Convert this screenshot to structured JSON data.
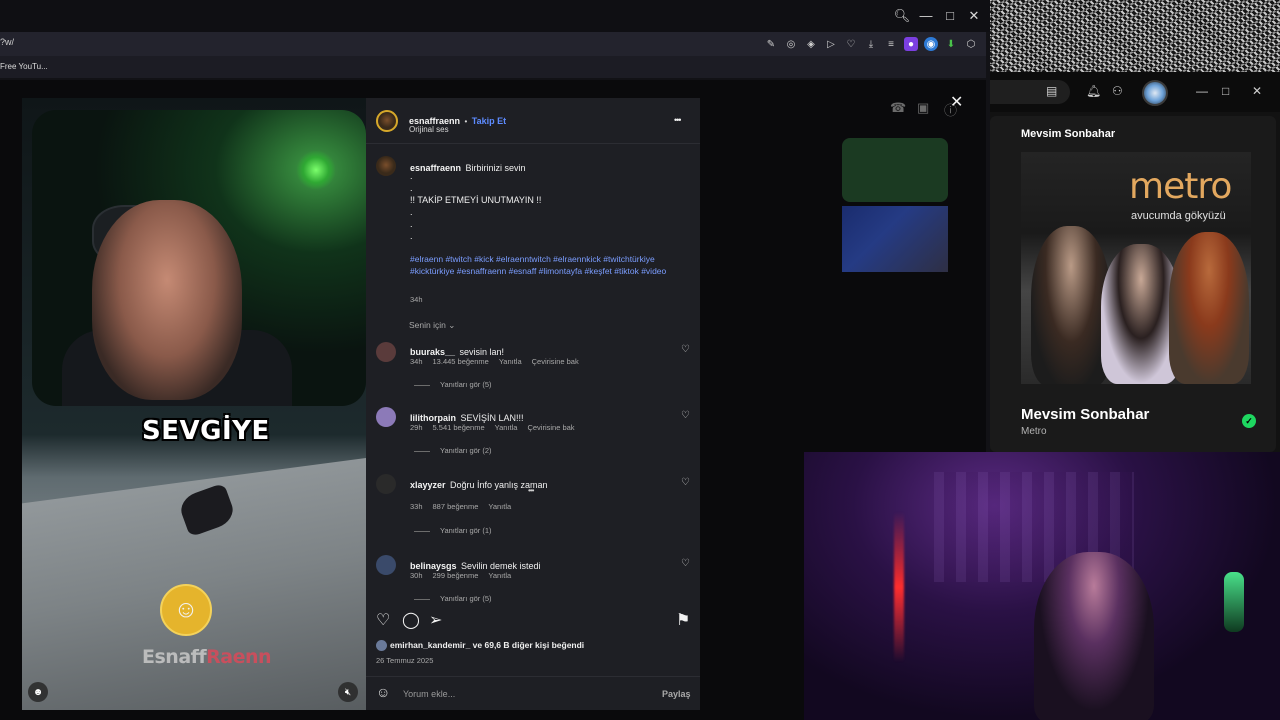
{
  "browser": {
    "url": "?w/",
    "bookmark": "Free YouTu...",
    "toolbar_icons": [
      "edit-icon",
      "camera-icon",
      "shield-icon",
      "play-icon",
      "heart-icon",
      "download-icon",
      "menu-icon",
      "profile-icon",
      "extension-blue-icon",
      "extension-green-icon",
      "extension-box-icon"
    ]
  },
  "post": {
    "username": "esnaffraenn",
    "separator": "•",
    "follow_label": "Takip Et",
    "audio": "Orijinal ses",
    "more": "•••",
    "caption_user": "esnaffraenn",
    "caption_text": "Birbirinizi sevin",
    "caption_lines": [
      ".",
      ".",
      "!! TAKİP ETMEYİ UNUTMAYIN !!",
      ".",
      ".",
      "."
    ],
    "hashtags": "#elraenn #twitch #kick #elraenntwitch #elraennkick #twitchtürkiye #kicktürkiye #esnaffraenn #esnaff #limontayfa #keşfet #tiktok #video",
    "caption_time": "34h",
    "for_you": "Senin için",
    "video_caption": "SEVGİYE",
    "logo_name_left": "Esnaff",
    "logo_name_right": "Raenn",
    "likes": "emirhan_kandemir_ ve 69,6 B diğer kişi beğendi",
    "date": "26 Temmuz 2025",
    "comment_placeholder": "Yorum ekle...",
    "share_label": "Paylaş"
  },
  "comments": [
    {
      "user": "buuraks__",
      "text": "sevisin lan!",
      "time": "34h",
      "likes": "13.445 beğenme",
      "reply": "Yanıtla",
      "translate": "Çevirisine bak",
      "replies": "Yanıtları gör (5)"
    },
    {
      "user": "lilithorpain",
      "text": "SEVİŞİN LAN!!!",
      "time": "29h",
      "likes": "5.541 beğenme",
      "reply": "Yanıtla",
      "translate": "Çevirisine bak",
      "replies": "Yanıtları gör (2)"
    },
    {
      "user": "xlayyzer",
      "text": "Doğru İnfo yanlış zaman",
      "time": "33h",
      "likes": "887 beğenme",
      "reply": "Yanıtla",
      "translate": "",
      "replies": "Yanıtları gör (1)"
    },
    {
      "user": "belinaysgs",
      "text": "Sevilin demek istedi",
      "time": "30h",
      "likes": "299 beğenme",
      "reply": "Yanıtla",
      "translate": "",
      "replies": "Yanıtları gör (5)"
    }
  ],
  "spotify": {
    "heading": "Mevsim Sonbahar",
    "album_brand": "metro",
    "album_tagline": "avucumda gökyüzü",
    "track_title": "Mevsim Sonbahar",
    "artist": "Metro"
  },
  "colors": {
    "follow": "#5d8bff",
    "hashtag": "#7b9dff",
    "spotify_green": "#1ed760"
  }
}
